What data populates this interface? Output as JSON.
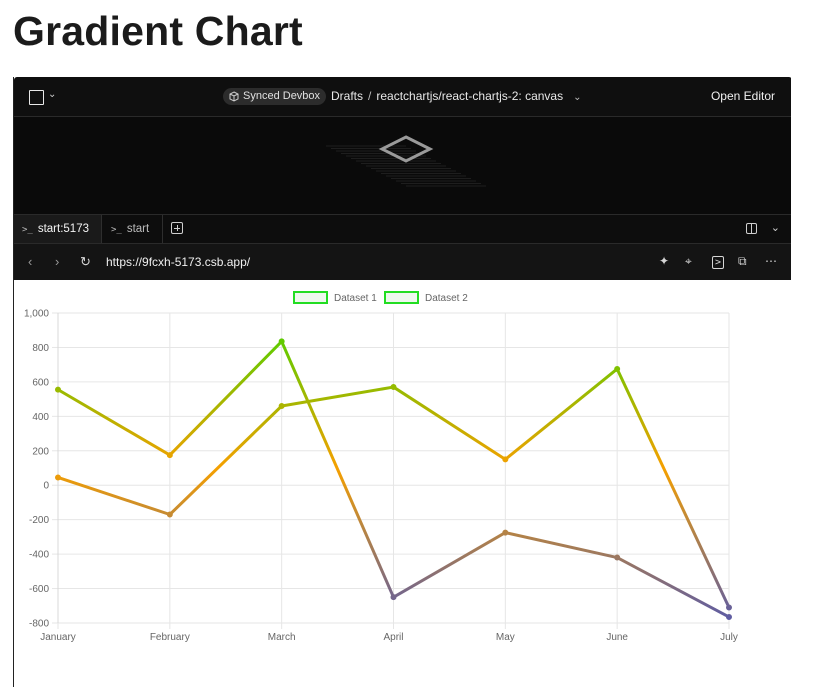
{
  "page": {
    "title": "Gradient Chart"
  },
  "topbar": {
    "badge": "Synced Devbox",
    "crumbs": [
      "Drafts",
      "reactchartjs/react-chartjs-2: canvas"
    ],
    "separator": "/",
    "open_editor": "Open Editor"
  },
  "tabs": [
    {
      "label": "start:5173"
    },
    {
      "label": "start"
    }
  ],
  "urlbar": {
    "url": "https://9fcxh-5173.csb.app/"
  },
  "chart_data": {
    "type": "line",
    "categories": [
      "January",
      "February",
      "March",
      "April",
      "May",
      "June",
      "July"
    ],
    "series": [
      {
        "name": "Dataset 1",
        "values": [
          555,
          175,
          835,
          -650,
          -275,
          -420,
          -765
        ]
      },
      {
        "name": "Dataset 2",
        "values": [
          45,
          -170,
          460,
          570,
          150,
          675,
          -710
        ]
      }
    ],
    "ylim": [
      -800,
      1000
    ],
    "yticks": [
      "1,000",
      "800",
      "600",
      "400",
      "200",
      "0",
      "-200",
      "-400",
      "-600",
      "-800"
    ],
    "grid": true,
    "legend": "top",
    "gradient_colors": {
      "low": "#5a5aa8",
      "mid": "#f5a000",
      "high": "#3fd400"
    },
    "legend_box_color": "#22dd22"
  }
}
